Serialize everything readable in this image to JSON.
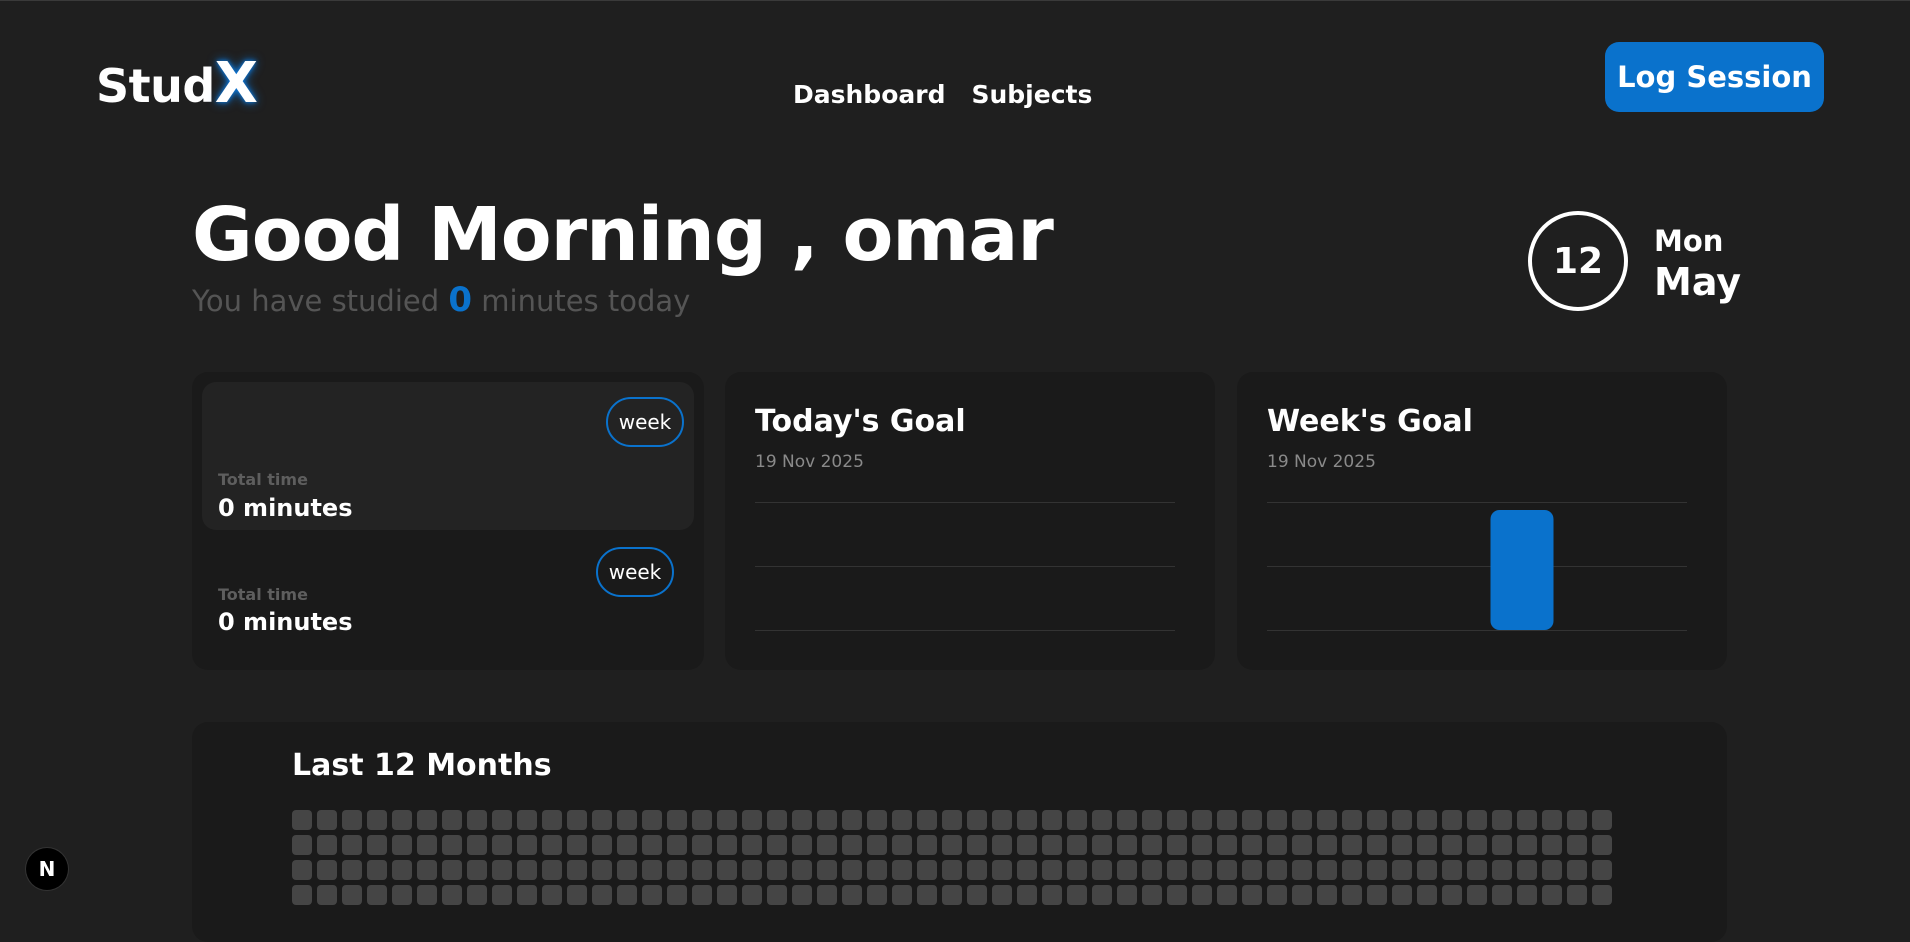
{
  "header": {
    "logo_main": "Stud",
    "logo_accent": "X",
    "nav": [
      "Dashboard",
      "Subjects"
    ],
    "log_session_label": "Log Session"
  },
  "greeting": {
    "title": "Good Morning , omar",
    "studied_prefix": "You have studied",
    "studied_minutes": "0",
    "studied_suffix": "minutes today"
  },
  "date": {
    "day_number": "12",
    "weekday": "Mon",
    "month": "May"
  },
  "total_time_cards": [
    {
      "toggle": "week",
      "label": "Total time",
      "value": "0 minutes"
    },
    {
      "toggle": "week",
      "label": "Total time",
      "value": "0 minutes"
    }
  ],
  "todays_goal": {
    "title": "Today's Goal",
    "date": "19 Nov 2025"
  },
  "weeks_goal": {
    "title": "Week's Goal",
    "date": "19 Nov 2025"
  },
  "heatmap": {
    "title": "Last 12 Months",
    "columns": 53,
    "visible_rows": 4,
    "cell_color": "#454545"
  },
  "colors": {
    "accent": "#0a72cc",
    "background": "#1f1f1f",
    "card": "#1a1a1a"
  },
  "chart_data": [
    {
      "type": "bar",
      "title": "Today's Goal",
      "categories": [],
      "values": [],
      "grid": true
    },
    {
      "type": "bar",
      "title": "Week's Goal",
      "categories": [
        ""
      ],
      "values": [
        1
      ],
      "ylim": [
        0,
        1
      ],
      "grid": true
    }
  ],
  "dev_badge": "N"
}
